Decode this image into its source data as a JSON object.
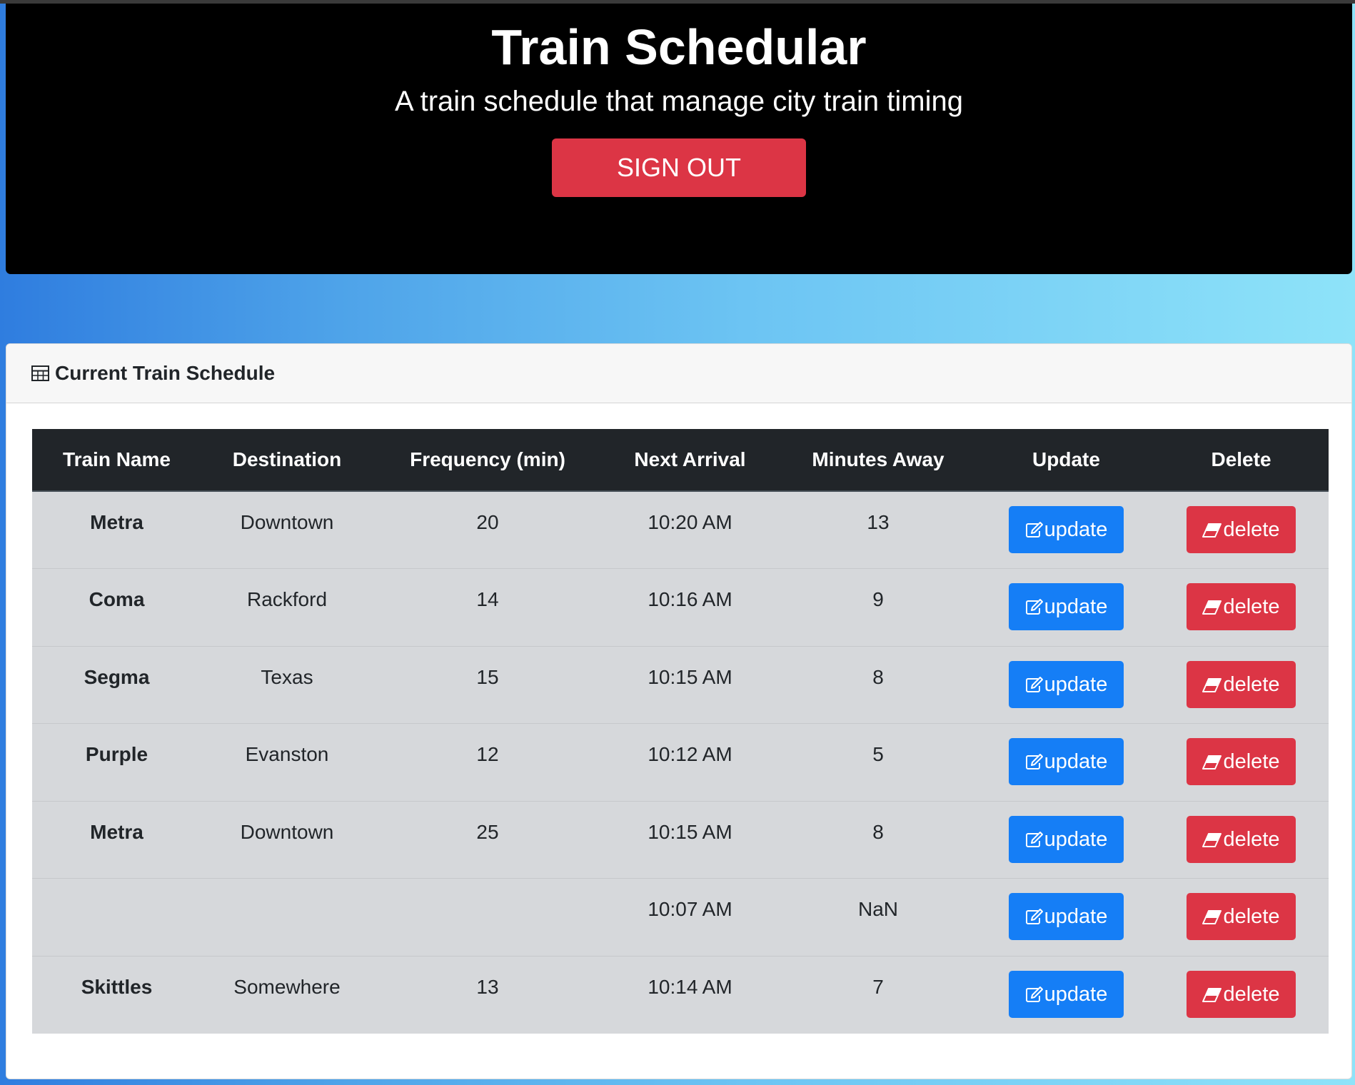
{
  "header": {
    "title": "Train Schedular",
    "subtitle": "A train schedule that manage city train timing",
    "signout_label": "SIGN OUT"
  },
  "schedule": {
    "title": "Current Train Schedule",
    "columns": [
      "Train Name",
      "Destination",
      "Frequency (min)",
      "Next Arrival",
      "Minutes Away",
      "Update",
      "Delete"
    ],
    "update_label": "update",
    "delete_label": "delete",
    "rows": [
      {
        "name": "Metra",
        "destination": "Downtown",
        "frequency": "20",
        "next_arrival": "10:20 AM",
        "minutes_away": "13"
      },
      {
        "name": "Coma",
        "destination": "Rackford",
        "frequency": "14",
        "next_arrival": "10:16 AM",
        "minutes_away": "9"
      },
      {
        "name": "Segma",
        "destination": "Texas",
        "frequency": "15",
        "next_arrival": "10:15 AM",
        "minutes_away": "8"
      },
      {
        "name": "Purple",
        "destination": "Evanston",
        "frequency": "12",
        "next_arrival": "10:12 AM",
        "minutes_away": "5"
      },
      {
        "name": "Metra",
        "destination": "Downtown",
        "frequency": "25",
        "next_arrival": "10:15 AM",
        "minutes_away": "8"
      },
      {
        "name": "",
        "destination": "",
        "frequency": "",
        "next_arrival": "10:07 AM",
        "minutes_away": "NaN"
      },
      {
        "name": "Skittles",
        "destination": "Somewhere",
        "frequency": "13",
        "next_arrival": "10:14 AM",
        "minutes_away": "7"
      }
    ]
  },
  "icons": {
    "table": "table-icon",
    "update": "edit-icon",
    "delete": "eraser-icon"
  },
  "colors": {
    "header_bg": "#000000",
    "danger": "#dc3545",
    "primary": "#157ef6",
    "table_head_bg": "#212529",
    "row_bg": "#d6d8db"
  }
}
